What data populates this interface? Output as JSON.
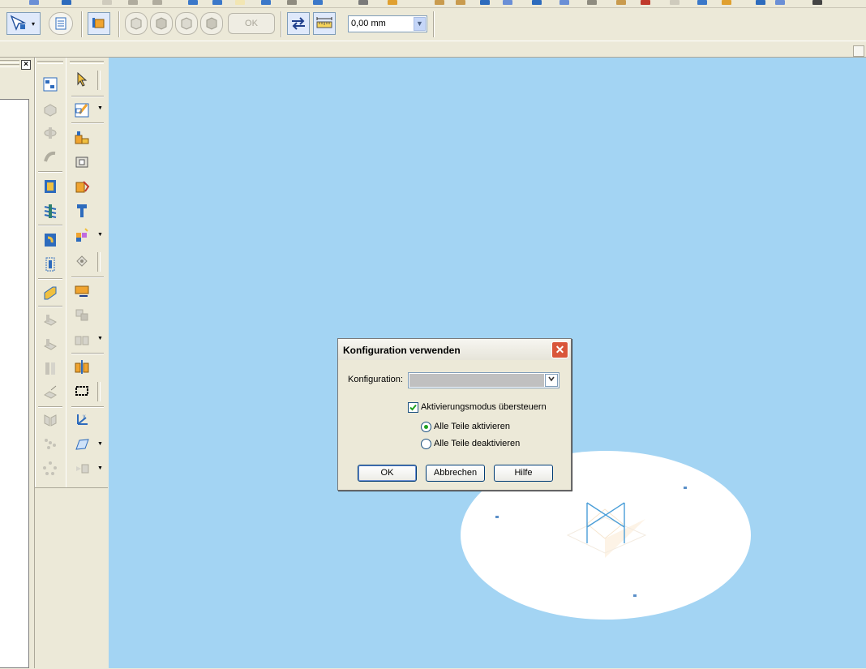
{
  "toolbar": {
    "ok_label": "OK",
    "offset_value": "0,00 mm"
  },
  "dialog": {
    "title": "Konfiguration verwenden",
    "close_glyph": "✕",
    "konfiguration_label": "Konfiguration:",
    "konfiguration_value": "",
    "override_checkbox_label": "Aktivierungsmodus übersteuern",
    "override_checked": true,
    "radio_activate_label": "Alle Teile aktivieren",
    "radio_deactivate_label": "Alle Teile deaktivieren",
    "selected_radio": "activate",
    "ok_button": "OK",
    "cancel_button": "Abbrechen",
    "help_button": "Hilfe"
  },
  "left_panel": {
    "close_glyph": "×"
  },
  "colors": {
    "viewport_bg": "#a3d4f3",
    "chrome": "#ece9d8",
    "dialog_close": "#d9553a",
    "check_green": "#21a121"
  }
}
